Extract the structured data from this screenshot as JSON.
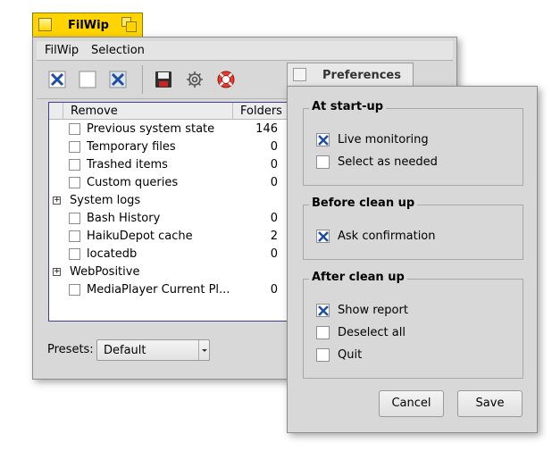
{
  "main_window": {
    "title": "FilWip",
    "menu": [
      "FilWip",
      "Selection"
    ],
    "toolbar_icons": [
      "select-all-icon",
      "deselect-all-icon",
      "invert-selection-icon",
      "save-icon",
      "settings-gear-icon",
      "lifebuoy-icon"
    ],
    "list": {
      "col_remove": "Remove",
      "col_folders": "Folders",
      "rows": [
        {
          "type": "item",
          "label": "Previous system state",
          "count": "146"
        },
        {
          "type": "item",
          "label": "Temporary files",
          "count": "0"
        },
        {
          "type": "item",
          "label": "Trashed items",
          "count": "0"
        },
        {
          "type": "item",
          "label": "Custom queries",
          "count": "0"
        },
        {
          "type": "group",
          "label": "System logs"
        },
        {
          "type": "item",
          "label": "Bash History",
          "count": "0"
        },
        {
          "type": "item",
          "label": "HaikuDepot cache",
          "count": "2"
        },
        {
          "type": "item",
          "label": "locatedb",
          "count": "0"
        },
        {
          "type": "group",
          "label": "WebPositive"
        },
        {
          "type": "item",
          "label": "MediaPlayer Current Pl...",
          "count": "0"
        }
      ]
    },
    "presets_label": "Presets:",
    "presets_value": "Default"
  },
  "preferences": {
    "title": "Preferences",
    "groups": [
      {
        "title": "At start-up",
        "options": [
          {
            "label": "Live monitoring",
            "checked": true
          },
          {
            "label": "Select as needed",
            "checked": false
          }
        ]
      },
      {
        "title": "Before clean up",
        "options": [
          {
            "label": "Ask confirmation",
            "checked": true
          }
        ]
      },
      {
        "title": "After clean up",
        "options": [
          {
            "label": "Show report",
            "checked": true
          },
          {
            "label": "Deselect all",
            "checked": false
          },
          {
            "label": "Quit",
            "checked": false
          }
        ]
      }
    ],
    "cancel_label": "Cancel",
    "save_label": "Save"
  },
  "colors": {
    "tab_yellow": "#ffd400",
    "check_blue": "#2255aa",
    "list_border": "#3c3cac"
  }
}
